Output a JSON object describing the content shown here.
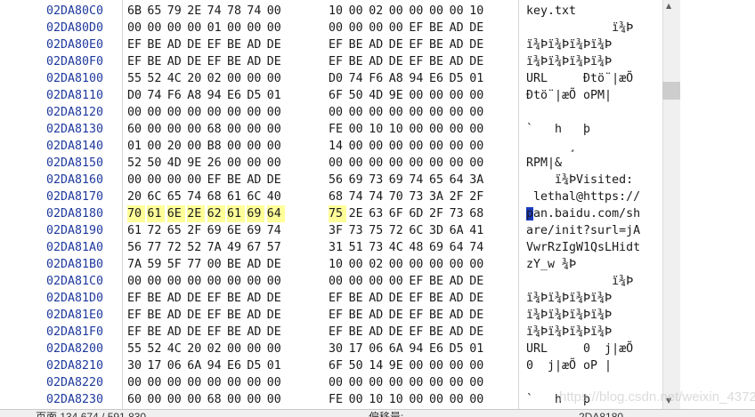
{
  "rows": [
    {
      "addr": "02DA80C0",
      "bytes": [
        "6B",
        "65",
        "79",
        "2E",
        "74",
        "78",
        "74",
        "00",
        "10",
        "00",
        "02",
        "00",
        "00",
        "00",
        "00",
        "10"
      ],
      "ascii": "key.txt"
    },
    {
      "addr": "02DA80D0",
      "bytes": [
        "00",
        "00",
        "00",
        "00",
        "01",
        "00",
        "00",
        "00",
        "00",
        "00",
        "00",
        "00",
        "EF",
        "BE",
        "AD",
        "DE"
      ],
      "ascii": "            ï¾­Þ"
    },
    {
      "addr": "02DA80E0",
      "bytes": [
        "EF",
        "BE",
        "AD",
        "DE",
        "EF",
        "BE",
        "AD",
        "DE",
        "EF",
        "BE",
        "AD",
        "DE",
        "EF",
        "BE",
        "AD",
        "DE"
      ],
      "ascii": "ï¾­Þï¾­Þï¾­Þï¾­Þ"
    },
    {
      "addr": "02DA80F0",
      "bytes": [
        "EF",
        "BE",
        "AD",
        "DE",
        "EF",
        "BE",
        "AD",
        "DE",
        "EF",
        "BE",
        "AD",
        "DE",
        "EF",
        "BE",
        "AD",
        "DE"
      ],
      "ascii": "ï¾­Þï¾­Þï¾­Þï¾­Þ"
    },
    {
      "addr": "02DA8100",
      "bytes": [
        "55",
        "52",
        "4C",
        "20",
        "02",
        "00",
        "00",
        "00",
        "D0",
        "74",
        "F6",
        "A8",
        "94",
        "E6",
        "D5",
        "01"
      ],
      "ascii": "URL     Ðtö¨|æÕ"
    },
    {
      "addr": "02DA8110",
      "bytes": [
        "D0",
        "74",
        "F6",
        "A8",
        "94",
        "E6",
        "D5",
        "01",
        "6F",
        "50",
        "4D",
        "9E",
        "00",
        "00",
        "00",
        "00"
      ],
      "ascii": "Ðtö¨|æÕ oPM|"
    },
    {
      "addr": "02DA8120",
      "bytes": [
        "00",
        "00",
        "00",
        "00",
        "00",
        "00",
        "00",
        "00",
        "00",
        "00",
        "00",
        "00",
        "00",
        "00",
        "00",
        "00"
      ],
      "ascii": ""
    },
    {
      "addr": "02DA8130",
      "bytes": [
        "60",
        "00",
        "00",
        "00",
        "68",
        "00",
        "00",
        "00",
        "FE",
        "00",
        "10",
        "10",
        "00",
        "00",
        "00",
        "00"
      ],
      "ascii": "`   h   þ"
    },
    {
      "addr": "02DA8140",
      "bytes": [
        "01",
        "00",
        "20",
        "00",
        "B8",
        "00",
        "00",
        "00",
        "14",
        "00",
        "00",
        "00",
        "00",
        "00",
        "00",
        "00"
      ],
      "ascii": "      ¸"
    },
    {
      "addr": "02DA8150",
      "bytes": [
        "52",
        "50",
        "4D",
        "9E",
        "26",
        "00",
        "00",
        "00",
        "00",
        "00",
        "00",
        "00",
        "00",
        "00",
        "00",
        "00"
      ],
      "ascii": "RPM|&"
    },
    {
      "addr": "02DA8160",
      "bytes": [
        "00",
        "00",
        "00",
        "00",
        "EF",
        "BE",
        "AD",
        "DE",
        "56",
        "69",
        "73",
        "69",
        "74",
        "65",
        "64",
        "3A"
      ],
      "ascii": "    ï¾­ÞVisited:"
    },
    {
      "addr": "02DA8170",
      "bytes": [
        "20",
        "6C",
        "65",
        "74",
        "68",
        "61",
        "6C",
        "40",
        "68",
        "74",
        "74",
        "70",
        "73",
        "3A",
        "2F",
        "2F"
      ],
      "ascii": " lethal@https://"
    },
    {
      "addr": "02DA8180",
      "bytes": [
        "70",
        "61",
        "6E",
        "2E",
        "62",
        "61",
        "69",
        "64",
        "75",
        "2E",
        "63",
        "6F",
        "6D",
        "2F",
        "73",
        "68"
      ],
      "ascii": "pan.baidu.com/sh"
    },
    {
      "addr": "02DA8190",
      "bytes": [
        "61",
        "72",
        "65",
        "2F",
        "69",
        "6E",
        "69",
        "74",
        "3F",
        "73",
        "75",
        "72",
        "6C",
        "3D",
        "6A",
        "41"
      ],
      "ascii": "are/init?surl=jA"
    },
    {
      "addr": "02DA81A0",
      "bytes": [
        "56",
        "77",
        "72",
        "52",
        "7A",
        "49",
        "67",
        "57",
        "31",
        "51",
        "73",
        "4C",
        "48",
        "69",
        "64",
        "74"
      ],
      "ascii": "VwrRzIgW1QsLHidt"
    },
    {
      "addr": "02DA81B0",
      "bytes": [
        "7A",
        "59",
        "5F",
        "77",
        "00",
        "BE",
        "AD",
        "DE",
        "10",
        "00",
        "02",
        "00",
        "00",
        "00",
        "00",
        "00"
      ],
      "ascii": "zY_w ¾­Þ"
    },
    {
      "addr": "02DA81C0",
      "bytes": [
        "00",
        "00",
        "00",
        "00",
        "00",
        "00",
        "00",
        "00",
        "00",
        "00",
        "00",
        "00",
        "EF",
        "BE",
        "AD",
        "DE"
      ],
      "ascii": "            ï¾­Þ"
    },
    {
      "addr": "02DA81D0",
      "bytes": [
        "EF",
        "BE",
        "AD",
        "DE",
        "EF",
        "BE",
        "AD",
        "DE",
        "EF",
        "BE",
        "AD",
        "DE",
        "EF",
        "BE",
        "AD",
        "DE"
      ],
      "ascii": "ï¾­Þï¾­Þï¾­Þï¾­Þ"
    },
    {
      "addr": "02DA81E0",
      "bytes": [
        "EF",
        "BE",
        "AD",
        "DE",
        "EF",
        "BE",
        "AD",
        "DE",
        "EF",
        "BE",
        "AD",
        "DE",
        "EF",
        "BE",
        "AD",
        "DE"
      ],
      "ascii": "ï¾­Þï¾­Þï¾­Þï¾­Þ"
    },
    {
      "addr": "02DA81F0",
      "bytes": [
        "EF",
        "BE",
        "AD",
        "DE",
        "EF",
        "BE",
        "AD",
        "DE",
        "EF",
        "BE",
        "AD",
        "DE",
        "EF",
        "BE",
        "AD",
        "DE"
      ],
      "ascii": "ï¾­Þï¾­Þï¾­Þï¾­Þ"
    },
    {
      "addr": "02DA8200",
      "bytes": [
        "55",
        "52",
        "4C",
        "20",
        "02",
        "00",
        "00",
        "00",
        "30",
        "17",
        "06",
        "6A",
        "94",
        "E6",
        "D5",
        "01"
      ],
      "ascii": "URL     0  j|æÕ"
    },
    {
      "addr": "02DA8210",
      "bytes": [
        "30",
        "17",
        "06",
        "6A",
        "94",
        "E6",
        "D5",
        "01",
        "6F",
        "50",
        "14",
        "9E",
        "00",
        "00",
        "00",
        "00"
      ],
      "ascii": "0  j|æÕ oP |"
    },
    {
      "addr": "02DA8220",
      "bytes": [
        "00",
        "00",
        "00",
        "00",
        "00",
        "00",
        "00",
        "00",
        "00",
        "00",
        "00",
        "00",
        "00",
        "00",
        "00",
        "00"
      ],
      "ascii": ""
    },
    {
      "addr": "02DA8230",
      "bytes": [
        "60",
        "00",
        "00",
        "00",
        "68",
        "00",
        "00",
        "00",
        "FE",
        "00",
        "10",
        "10",
        "00",
        "00",
        "00",
        "00"
      ],
      "ascii": "`   h   þ"
    }
  ],
  "highlight": {
    "row": 12,
    "from": 0,
    "to": 8
  },
  "cursor": {
    "row": 12,
    "char": "p"
  },
  "status": {
    "page": "页面 134,674 / 591,830",
    "offset_label": "偏移量:",
    "offset_value": "2DA8180"
  },
  "watermark": "https://blog.csdn.net/weixin_43721828"
}
